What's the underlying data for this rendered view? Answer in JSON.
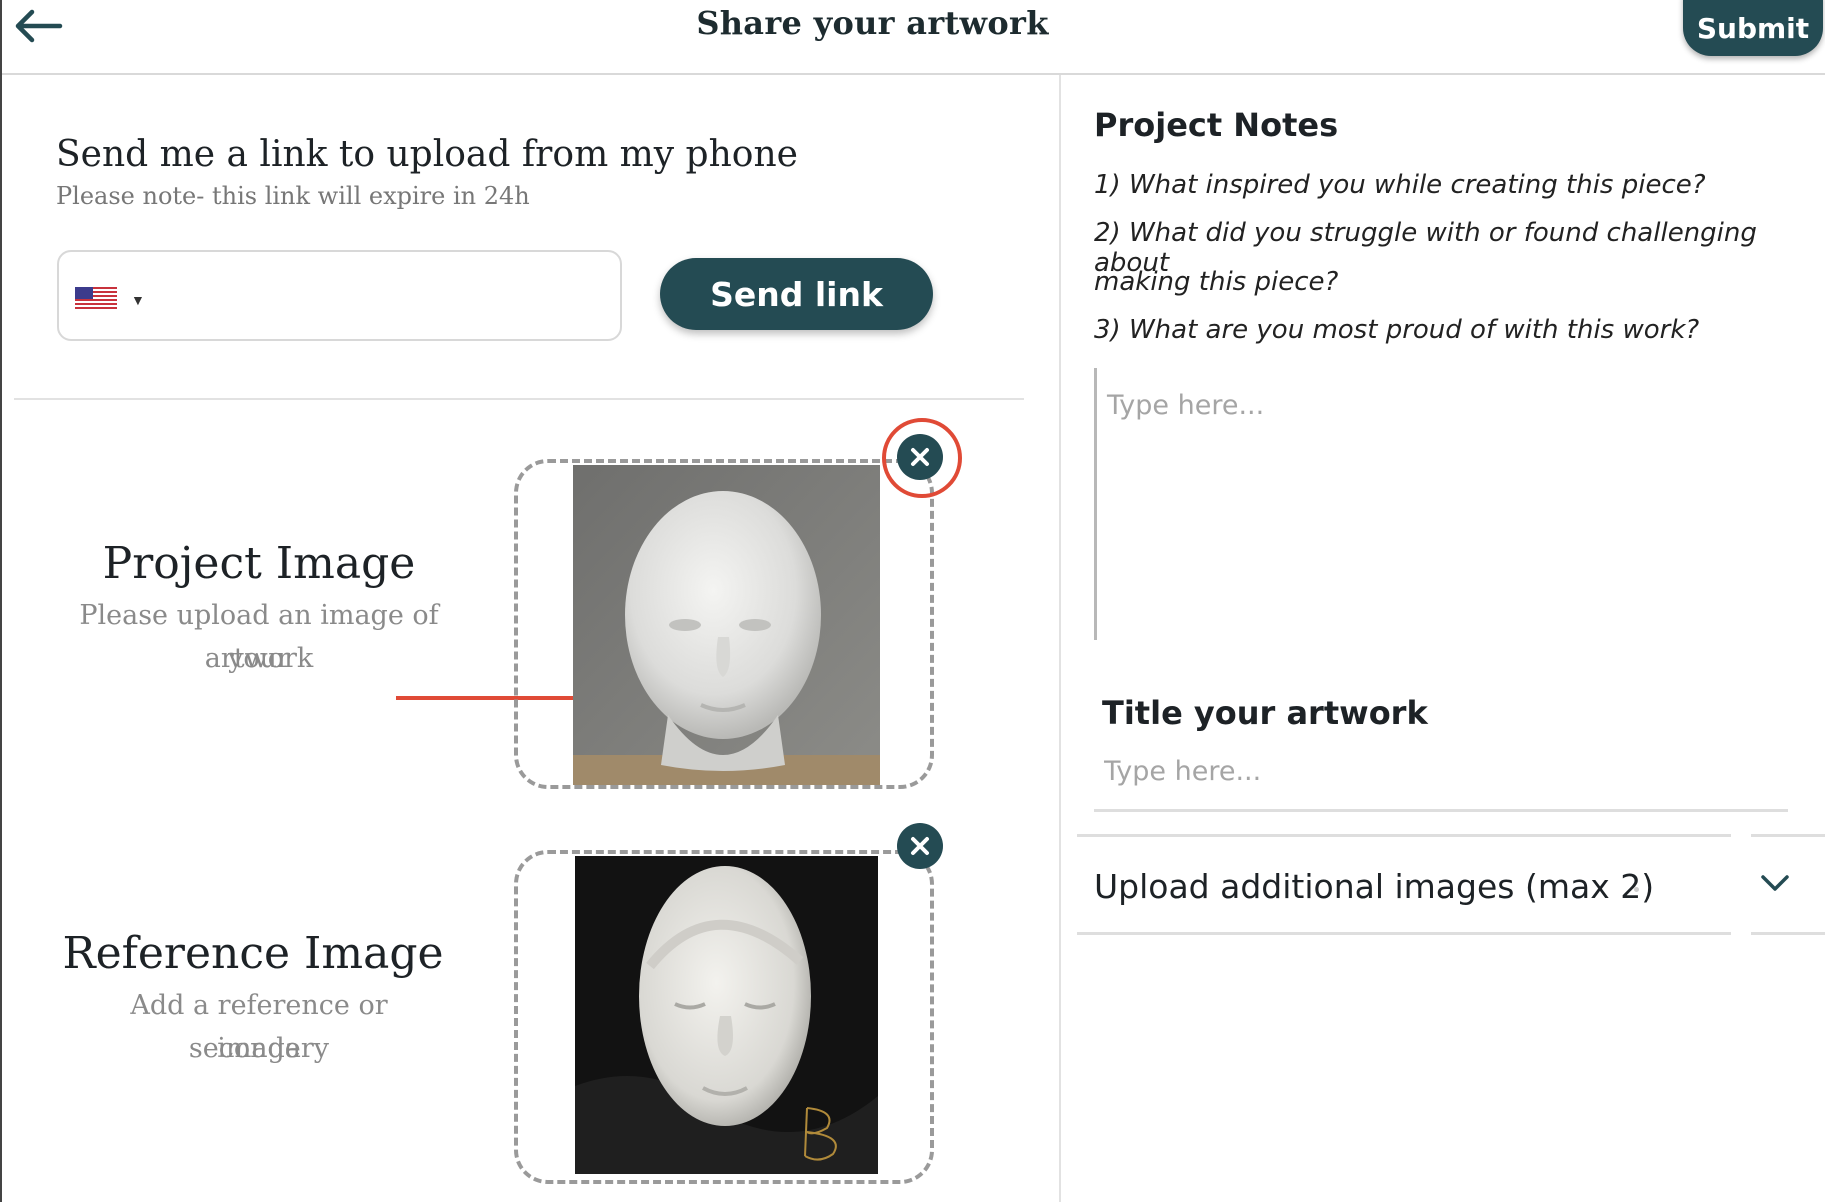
{
  "header": {
    "title": "Share your artwork",
    "submit_label": "Submit",
    "back_icon": "arrow-left-icon"
  },
  "send_link": {
    "title": "Send me a link to upload from my phone",
    "subtitle": "Please note- this link will expire in 24h",
    "phone_value": "",
    "country": "US",
    "button_label": "Send link"
  },
  "project_image": {
    "title": "Project Image",
    "desc_line1": "Please upload an image of your",
    "desc_line2": "artwork",
    "remove_icon": "close-circle-icon"
  },
  "reference_image": {
    "title": "Reference Image",
    "desc_line1": "Add a reference or secondary",
    "desc_line2": "image",
    "remove_icon": "close-circle-icon",
    "signature_letter": "B"
  },
  "notes": {
    "title": "Project Notes",
    "questions": [
      "1) What inspired you while creating this piece?",
      "2) What did you struggle with or found challenging about",
      "making this piece?",
      "3) What are you most proud of with this work?"
    ],
    "placeholder": "Type here..."
  },
  "artwork_title": {
    "label": "Title your artwork",
    "placeholder": "Type here..."
  },
  "additional_images": {
    "label": "Upload additional images (max 2)",
    "icon": "chevron-down-icon"
  },
  "colors": {
    "primary": "#244b53",
    "annotation": "#e04a36"
  }
}
